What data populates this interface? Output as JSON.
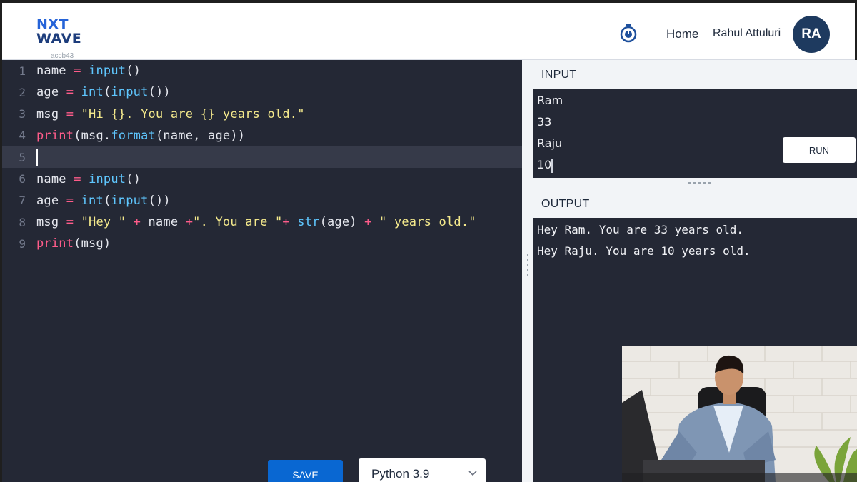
{
  "header": {
    "logo_line1": "NXT",
    "logo_line2": "WAVE",
    "logo_sub": "accb43",
    "nav_home": "Home",
    "user_name": "Rahul Attuluri",
    "avatar_initials": "RA",
    "timer_icon": "stopwatch-icon"
  },
  "editor": {
    "lines": [
      {
        "num": "1",
        "tokens": [
          {
            "t": "name ",
            "c": ""
          },
          {
            "t": "=",
            "c": "op"
          },
          {
            "t": " ",
            "c": ""
          },
          {
            "t": "input",
            "c": "fn"
          },
          {
            "t": "()",
            "c": ""
          }
        ]
      },
      {
        "num": "2",
        "tokens": [
          {
            "t": "age ",
            "c": ""
          },
          {
            "t": "=",
            "c": "op"
          },
          {
            "t": " ",
            "c": ""
          },
          {
            "t": "int",
            "c": "fn"
          },
          {
            "t": "(",
            "c": ""
          },
          {
            "t": "input",
            "c": "fn"
          },
          {
            "t": "())",
            "c": ""
          }
        ]
      },
      {
        "num": "3",
        "tokens": [
          {
            "t": "msg ",
            "c": ""
          },
          {
            "t": "=",
            "c": "op"
          },
          {
            "t": " ",
            "c": ""
          },
          {
            "t": "\"Hi {}. You are {} years old.\"",
            "c": "str"
          }
        ]
      },
      {
        "num": "4",
        "tokens": [
          {
            "t": "print",
            "c": "op"
          },
          {
            "t": "(msg.",
            "c": ""
          },
          {
            "t": "format",
            "c": "fn"
          },
          {
            "t": "(name, age))",
            "c": ""
          }
        ]
      },
      {
        "num": "5",
        "tokens": [],
        "active": true
      },
      {
        "num": "6",
        "tokens": [
          {
            "t": "name ",
            "c": ""
          },
          {
            "t": "=",
            "c": "op"
          },
          {
            "t": " ",
            "c": ""
          },
          {
            "t": "input",
            "c": "fn"
          },
          {
            "t": "()",
            "c": ""
          }
        ]
      },
      {
        "num": "7",
        "tokens": [
          {
            "t": "age ",
            "c": ""
          },
          {
            "t": "=",
            "c": "op"
          },
          {
            "t": " ",
            "c": ""
          },
          {
            "t": "int",
            "c": "fn"
          },
          {
            "t": "(",
            "c": ""
          },
          {
            "t": "input",
            "c": "fn"
          },
          {
            "t": "())",
            "c": ""
          }
        ]
      },
      {
        "num": "8",
        "tokens": [
          {
            "t": "msg ",
            "c": ""
          },
          {
            "t": "=",
            "c": "op"
          },
          {
            "t": " ",
            "c": ""
          },
          {
            "t": "\"Hey \"",
            "c": "str"
          },
          {
            "t": " ",
            "c": ""
          },
          {
            "t": "+",
            "c": "op"
          },
          {
            "t": " name ",
            "c": ""
          },
          {
            "t": "+",
            "c": "op"
          },
          {
            "t": "\". You are \"",
            "c": "str"
          },
          {
            "t": "+",
            "c": "op"
          },
          {
            "t": " ",
            "c": ""
          },
          {
            "t": "str",
            "c": "fn"
          },
          {
            "t": "(age) ",
            "c": ""
          },
          {
            "t": "+",
            "c": "op"
          },
          {
            "t": " ",
            "c": ""
          },
          {
            "t": "\" years old.\"",
            "c": "str"
          }
        ]
      },
      {
        "num": "9",
        "tokens": [
          {
            "t": "print",
            "c": "op"
          },
          {
            "t": "(msg)",
            "c": ""
          }
        ]
      }
    ],
    "save_label": "SAVE",
    "language": "Python 3.9"
  },
  "io": {
    "input_label": "INPUT",
    "input_lines": [
      "Ram",
      "33",
      "Raju",
      "10"
    ],
    "run_label": "RUN",
    "output_label": "OUTPUT",
    "output_lines": [
      "Hey Ram. You are 33 years old.",
      "Hey Raju. You are 10 years old."
    ]
  },
  "colors": {
    "editor_bg": "#242835",
    "keyword_pink": "#ff5c8a",
    "function_blue": "#5fc7ff",
    "string_yellow": "#f4e98c",
    "save_blue": "#0967d2",
    "avatar_navy": "#1e3a5f"
  }
}
